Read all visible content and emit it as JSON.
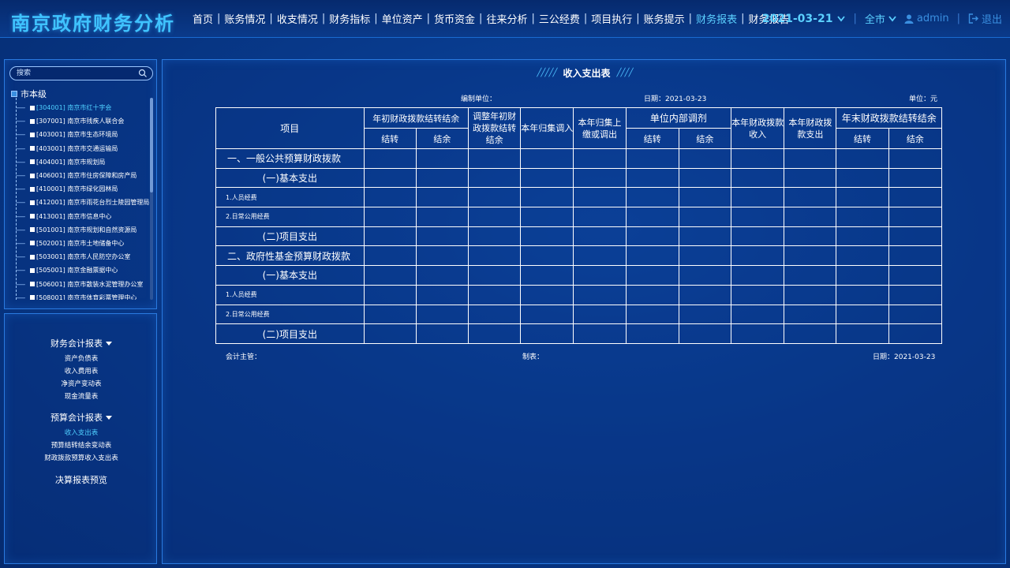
{
  "app": {
    "title": "南京政府财务分析"
  },
  "nav": {
    "items": [
      {
        "label": "首页",
        "active": false
      },
      {
        "label": "账务情况",
        "active": false
      },
      {
        "label": "收支情况",
        "active": false
      },
      {
        "label": "财务指标",
        "active": false
      },
      {
        "label": "单位资产",
        "active": false
      },
      {
        "label": "货币资金",
        "active": false
      },
      {
        "label": "往来分析",
        "active": false
      },
      {
        "label": "三公经费",
        "active": false
      },
      {
        "label": "项目执行",
        "active": false
      },
      {
        "label": "账务提示",
        "active": false
      },
      {
        "label": "财务报表",
        "active": true
      },
      {
        "label": "财务报告",
        "active": false
      }
    ]
  },
  "header": {
    "date": "2021-03-21",
    "region": "全市",
    "user": "admin",
    "logout": "退出"
  },
  "sidebar": {
    "search_placeholder": "搜索",
    "tree_root": "市本级",
    "tree_items": [
      {
        "label": "[304001] 南京市红十字会",
        "active": true
      },
      {
        "label": "[307001] 南京市残疾人联合会",
        "active": false
      },
      {
        "label": "[403001] 南京市生态环境局",
        "active": false
      },
      {
        "label": "[403001] 南京市交通运输局",
        "active": false
      },
      {
        "label": "[404001] 南京市规划局",
        "active": false
      },
      {
        "label": "[406001] 南京市住房保障和房产局",
        "active": false
      },
      {
        "label": "[410001] 南京市绿化园林局",
        "active": false
      },
      {
        "label": "[412001] 南京市雨花台烈士陵园管理局",
        "active": false
      },
      {
        "label": "[413001] 南京市信息中心",
        "active": false
      },
      {
        "label": "[501001] 南京市规划和自然资源局",
        "active": false
      },
      {
        "label": "[502001] 南京市土地储备中心",
        "active": false
      },
      {
        "label": "[503001] 南京市人民防空办公室",
        "active": false
      },
      {
        "label": "[505001] 南京金融票据中心",
        "active": false
      },
      {
        "label": "[506001] 南京市散装水泥管理办公室",
        "active": false
      },
      {
        "label": "[508001] 南京市体育彩票管理中心",
        "active": false
      }
    ],
    "menu": {
      "group1": {
        "title": "财务会计报表",
        "items": [
          {
            "label": "资产负债表",
            "active": false
          },
          {
            "label": "收入费用表",
            "active": false
          },
          {
            "label": "净资产变动表",
            "active": false
          },
          {
            "label": "现金流量表",
            "active": false
          }
        ]
      },
      "group2": {
        "title": "预算会计报表",
        "items": [
          {
            "label": "收入支出表",
            "active": true
          },
          {
            "label": "预算结转结余变动表",
            "active": false
          },
          {
            "label": "财政拨款预算收入支出表",
            "active": false
          }
        ]
      },
      "group3": {
        "title": "决算报表预览"
      }
    }
  },
  "report": {
    "title": "收入支出表",
    "prepared_by_label": "编制单位：",
    "date_label": "日期：2021-03-23",
    "unit_label": "单位：元",
    "headers": {
      "item": "项目",
      "begin": "年初财政拨款结转结余",
      "begin_carry": "结转",
      "begin_balance": "结余",
      "adjust": "调整年初财政拨款结转结余",
      "collect_in": "本年归集调入",
      "collect_out": "本年归集上缴或调出",
      "internal": "单位内部调剂",
      "internal_carry": "结转",
      "internal_balance": "结余",
      "income": "本年财政拨款收入",
      "expense": "本年财政拨款支出",
      "end": "年末财政拨款结转结余",
      "end_carry": "结转",
      "end_balance": "结余"
    },
    "rows": [
      {
        "label": "一、一般公共预算财政拨款",
        "level": 1
      },
      {
        "label": "(一)基本支出",
        "level": 2
      },
      {
        "label": "1.人员经费",
        "level": 3
      },
      {
        "label": "2.日常公用经费",
        "level": 3
      },
      {
        "label": "(二)项目支出",
        "level": 2
      },
      {
        "label": "二、政府性基金预算财政拨款",
        "level": 1
      },
      {
        "label": "(一)基本支出",
        "level": 2
      },
      {
        "label": "1.人员经费",
        "level": 3
      },
      {
        "label": "2.日常公用经费",
        "level": 3
      },
      {
        "label": "(二)项目支出",
        "level": 2
      }
    ],
    "footer": {
      "supervisor": "会计主管：",
      "tabulator": "制表：",
      "date": "日期：2021-03-23"
    }
  }
}
